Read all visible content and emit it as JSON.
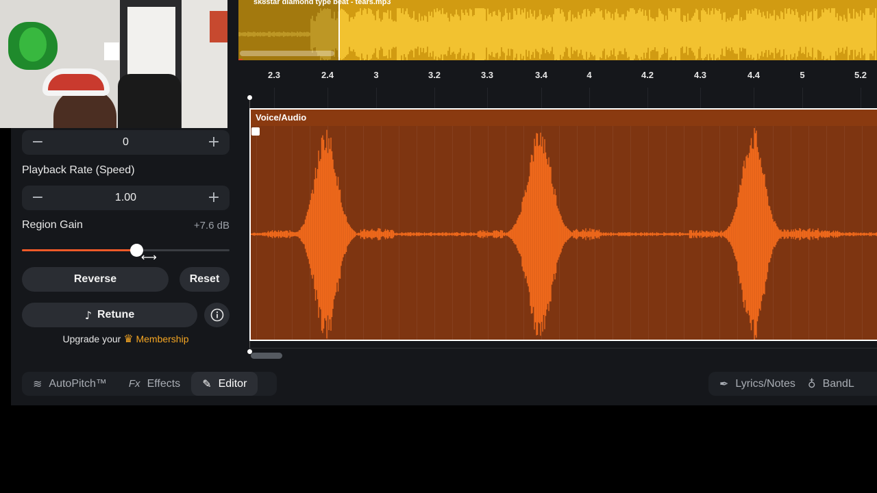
{
  "track": {
    "top_file_title": "sk8star  diamond type beat - tears.mp3",
    "region_label": "Voice/Audio"
  },
  "ruler": {
    "ticks": [
      "2.3",
      "2.4",
      "3",
      "3.2",
      "3.3",
      "3.4",
      "4",
      "4.2",
      "4.3",
      "4.4",
      "5",
      "5.2"
    ]
  },
  "controls": {
    "pitch_value": "0",
    "playback_rate_label": "Playback Rate (Speed)",
    "playback_rate_value": "1.00",
    "region_gain_label": "Region Gain",
    "region_gain_value": "+7.6 dB",
    "region_gain_slider_fraction": 0.55,
    "reverse_label": "Reverse",
    "reset_label": "Reset",
    "retune_label": "Retune",
    "upgrade_text": "Upgrade your",
    "membership_label": "Membership"
  },
  "tabs": {
    "autopitch": "AutoPitch™",
    "effects": "Effects",
    "editor": "Editor",
    "lyrics": "Lyrics/Notes",
    "bandlab": "BandL"
  },
  "icons": {
    "minus": "minus-icon",
    "plus": "plus-icon",
    "info": "info-icon",
    "retune": "retune-icon",
    "crown": "crown-icon",
    "autopitch": "autopitch-icon",
    "effects": "fx-icon",
    "editor": "pencil-icon",
    "lyrics": "feather-icon",
    "bandlab": "bandlab-icon"
  },
  "colors": {
    "accent": "#f05a28",
    "region_bg": "#7e3511",
    "waveform": "#f26a1b",
    "top_track": "#d19b12",
    "membership": "#f5a623"
  }
}
